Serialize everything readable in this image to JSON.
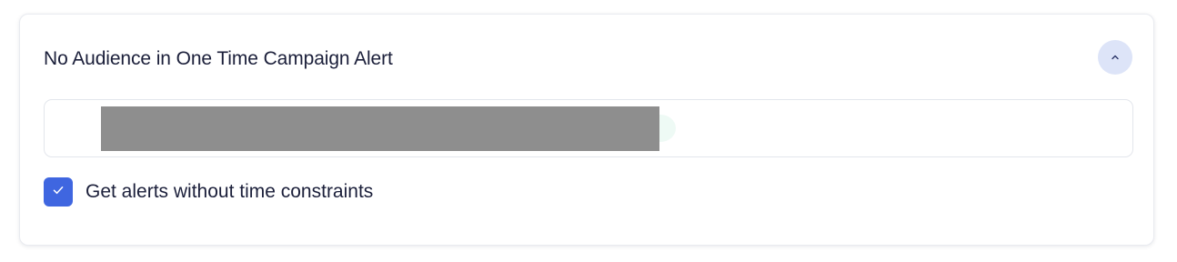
{
  "alert": {
    "title": "No Audience in One Time Campaign Alert",
    "collapse_icon": "chevron-up-icon",
    "field_value": "",
    "checkbox": {
      "label": "Get alerts without time constraints",
      "checked": true
    }
  },
  "colors": {
    "accent": "#3f66e0",
    "collapse_bg": "#dde4f8",
    "text": "#1b1f3a",
    "redaction": "#8e8e8e"
  }
}
